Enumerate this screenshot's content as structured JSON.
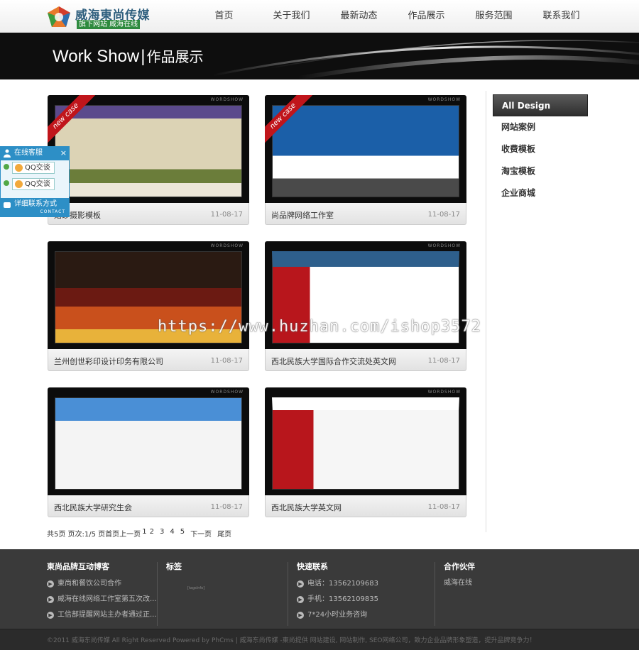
{
  "header": {
    "brand": "威海東尚传媒",
    "slogan": "旗下网站 威海在线",
    "nav": [
      "首页",
      "关于我们",
      "最新动态",
      "作品展示",
      "服务范围",
      "联系我们"
    ]
  },
  "banner": {
    "title_en": "Work Show",
    "separator": "|",
    "title_cn": "作品展示"
  },
  "works": [
    {
      "title": "婚纱摄影模板",
      "date": "11-08-17",
      "new": true,
      "badge": "new case",
      "mark": "WORDSHOW"
    },
    {
      "title": "尚品牌网络工作室",
      "date": "11-08-17",
      "new": true,
      "badge": "new case",
      "mark": "WORDSHOW"
    },
    {
      "title": "兰州创世彩印设计印务有限公司",
      "date": "11-08-17",
      "new": false,
      "mark": "WORDSHOW"
    },
    {
      "title": "西北民族大学国际合作交流处英文网",
      "date": "11-08-17",
      "new": false,
      "mark": "WORDSHOW"
    },
    {
      "title": "西北民族大学研究生会",
      "date": "11-08-17",
      "new": false,
      "mark": "WORDSHOW"
    },
    {
      "title": "西北民族大学英文网",
      "date": "11-08-17",
      "new": false,
      "mark": "WORDSHOW"
    }
  ],
  "sidebar": {
    "items": [
      "All Design",
      "网站案例",
      "收费模板",
      "淘宝模板",
      "企业商城"
    ],
    "active": 0
  },
  "pager": {
    "summary": "共5页 页次:1/5 页首页上一页",
    "pages": [
      "1",
      "2",
      "3",
      "4",
      "5"
    ],
    "next": "下一页",
    "last": "尾页"
  },
  "service": {
    "title": "在线客服",
    "close": "×",
    "qq": [
      "QQ交谈",
      "QQ交谈"
    ],
    "contact": "详细联系方式",
    "contact_sub": "CONTACT"
  },
  "footer": {
    "blog_title": "東尚品牌互动博客",
    "blog_items": [
      "東尚和餐饮公司合作",
      "威海在线网络工作室第五次改...",
      "工信部提醒网站主办者通过正..."
    ],
    "tags_title": "标签",
    "tags_placeholder": "[tagsInfo]",
    "contact_title": "快速联系",
    "contact_items": [
      "电话：13562109683",
      "手机：13562109835",
      "7*24小时业务咨询"
    ],
    "partner_title": "合作伙伴",
    "partner_items": [
      "威海在线"
    ],
    "copyright": "©2011 威海东尚传媒 All Right Reserved Powered by PhCms | 威海东尚传媒 -東尚提供 网站建设, 网站制作, SEO网络公司，致力企业品牌形象塑造，提升品牌竞争力！"
  },
  "watermark": "https://www.huzhan.com/ishop3572",
  "colors": {
    "brand_blue": "#2f5f7e",
    "ribbon_red": "#c0151b",
    "service_blue": "#2d8fc6",
    "footer_bg": "#3a3a3a"
  }
}
